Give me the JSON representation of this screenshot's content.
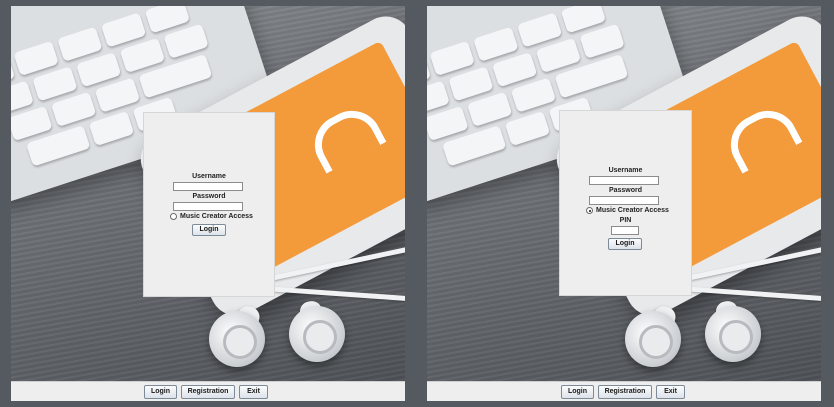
{
  "screens": [
    {
      "state": "default",
      "login_form": {
        "username_label": "Username",
        "username_value": "",
        "password_label": "Password",
        "password_value": "",
        "music_creator_access_label": "Music Creator Access",
        "music_creator_access_checked": false,
        "login_button": "Login"
      },
      "bottom_bar": {
        "login": "Login",
        "registration": "Registration",
        "exit": "Exit"
      }
    },
    {
      "state": "music-creator-access",
      "login_form": {
        "username_label": "Username",
        "username_value": "",
        "password_label": "Password",
        "password_value": "",
        "music_creator_access_label": "Music Creator Access",
        "music_creator_access_checked": true,
        "pin_label": "PIN",
        "pin_value": "",
        "login_button": "Login"
      },
      "bottom_bar": {
        "login": "Login",
        "registration": "Registration",
        "exit": "Exit"
      }
    }
  ],
  "colors": {
    "app_background": "#555a60",
    "card": "#eeeeee",
    "phone_screen": "#f39a3b"
  },
  "background_image": "desk-keyboard-phone-earbuds-photo"
}
